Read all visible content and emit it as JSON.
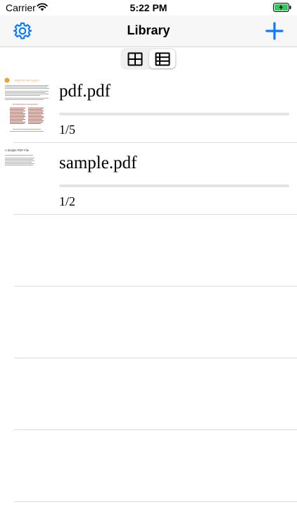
{
  "status_bar": {
    "carrier": "Carrier",
    "time": "5:22 PM"
  },
  "nav": {
    "title": "Library"
  },
  "view_toggle": {
    "selected": "list"
  },
  "documents": [
    {
      "name": "pdf.pdf",
      "pages": "1/5",
      "progress": 0
    },
    {
      "name": "sample.pdf",
      "pages": "1/2",
      "progress": 0
    }
  ],
  "thumbnails": {
    "doc1": {
      "heading": "Using PDF with eyeDoc",
      "subheading": "Formatting tips for your document"
    },
    "doc2": {
      "heading": "A Simple PDF File"
    }
  },
  "colors": {
    "accent": "#0a7aff",
    "battery": "#34c759",
    "thumb_highlight": "#f0a030",
    "thumb_red": "#c0392b"
  }
}
